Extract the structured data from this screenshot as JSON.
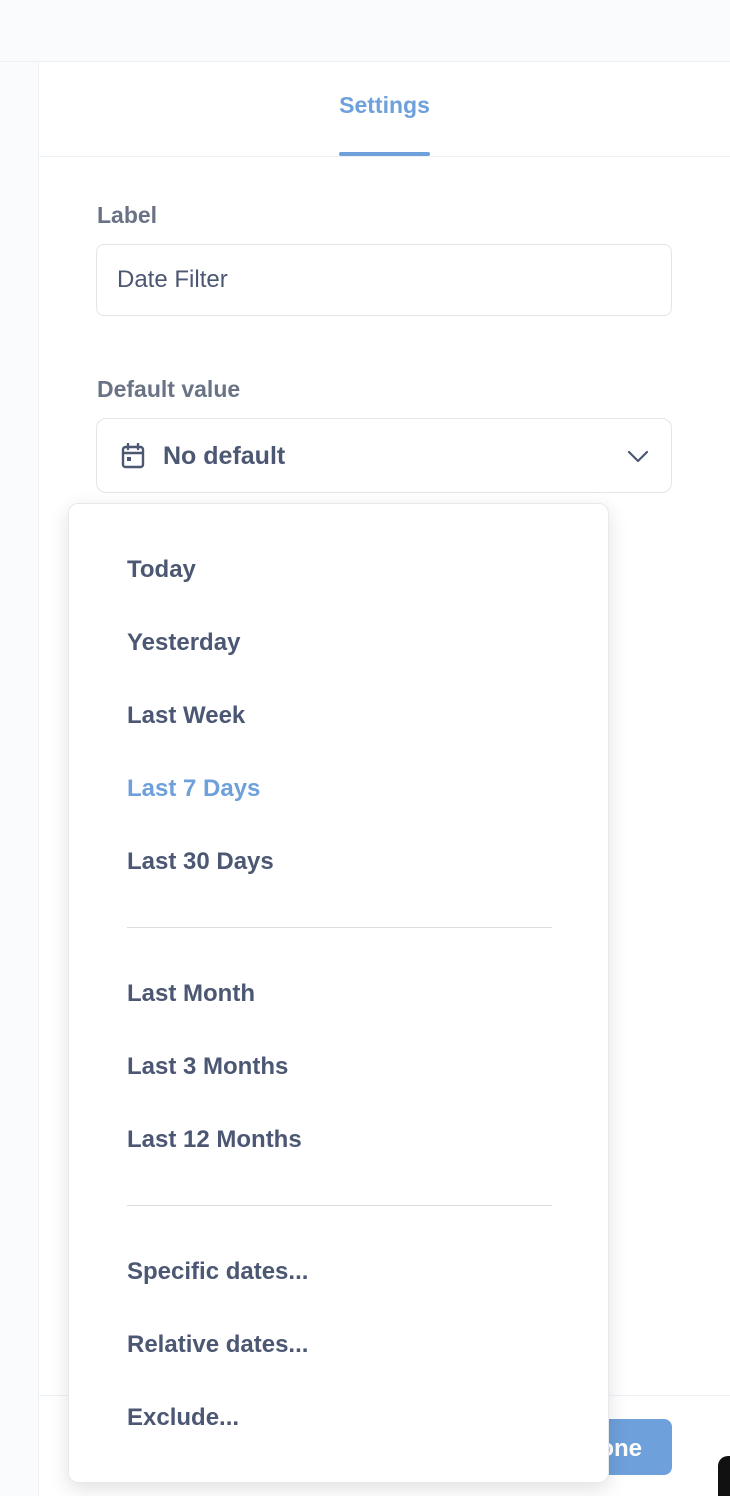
{
  "tabs": {
    "settings": "Settings"
  },
  "label_field": {
    "label": "Label",
    "value": "Date Filter"
  },
  "default_field": {
    "label": "Default value",
    "selected": "No default",
    "icon": "calendar-icon"
  },
  "options": {
    "group1": [
      "Today",
      "Yesterday",
      "Last Week",
      "Last 7 Days",
      "Last 30 Days"
    ],
    "group2": [
      "Last Month",
      "Last 3 Months",
      "Last 12 Months"
    ],
    "group3": [
      "Specific dates...",
      "Relative dates...",
      "Exclude..."
    ],
    "active": "Last 7 Days"
  },
  "footer": {
    "done_label": "Done"
  },
  "colors": {
    "accent": "#6ea0dc",
    "text": "#4c5773",
    "muted": "#6a7386"
  }
}
